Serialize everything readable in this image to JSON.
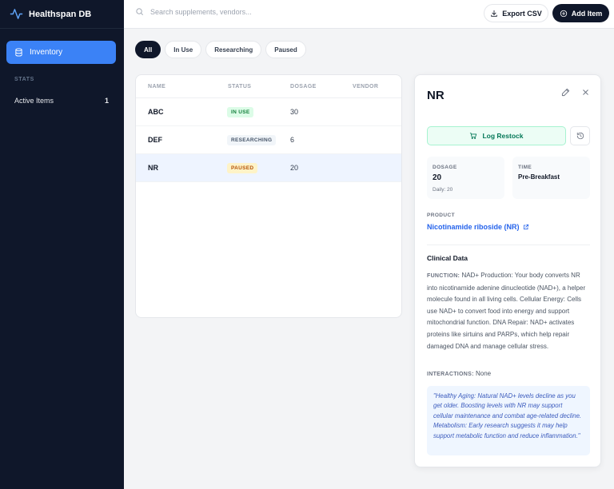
{
  "app": {
    "title": "Healthspan DB"
  },
  "sidebar": {
    "nav_label": "Inventory",
    "stats_header": "STATS",
    "stats": [
      {
        "label": "Active Items",
        "value": "1"
      }
    ]
  },
  "topbar": {
    "search_placeholder": "Search supplements, vendors...",
    "export_label": "Export CSV",
    "add_label": "Add Item"
  },
  "filters": [
    "All",
    "In Use",
    "Researching",
    "Paused"
  ],
  "table": {
    "columns": [
      "NAME",
      "STATUS",
      "DOSAGE",
      "VENDOR"
    ],
    "rows": [
      {
        "name": "ABC",
        "status": "IN USE",
        "dosage": "30",
        "vendor": ""
      },
      {
        "name": "DEF",
        "status": "RESEARCHING",
        "dosage": "6",
        "vendor": ""
      },
      {
        "name": "NR",
        "status": "PAUSED",
        "dosage": "20",
        "vendor": ""
      }
    ]
  },
  "status_colors": {
    "in_use": {
      "bg": "#dcfce7",
      "fg": "#15803d"
    },
    "researching": {
      "bg": "#f1f5f9",
      "fg": "#475569"
    },
    "paused": {
      "bg": "#fef3c7",
      "fg": "#b45309"
    }
  },
  "detail": {
    "title": "NR",
    "log_restock_label": "Log Restock",
    "dosage_label": "DOSAGE",
    "dosage_value": "20",
    "dosage_sub": "Daily: 20",
    "time_label": "TIME",
    "time_value": "Pre-Breakfast",
    "product_label": "PRODUCT",
    "product_name": "Nicotinamide riboside (NR)",
    "clinical_title": "Clinical Data",
    "function_label": "FUNCTION:",
    "function_text": "NAD+ Production: Your body converts NR into nicotinamide adenine dinucleotide (NAD+), a helper molecule found in all living cells. Cellular Energy: Cells use NAD+ to convert food into energy and support mitochondrial function. DNA Repair: NAD+ activates proteins like sirtuins and PARPs, which help repair damaged DNA and manage cellular stress.",
    "interactions_label": "INTERACTIONS:",
    "interactions_value": "None",
    "quote": "\"Healthy Aging: Natural NAD+ levels decline as you get older. Boosting levels with NR may support cellular maintenance and combat age-related decline. Metabolism: Early research suggests it may help support metabolic function and reduce inflammation.\""
  }
}
